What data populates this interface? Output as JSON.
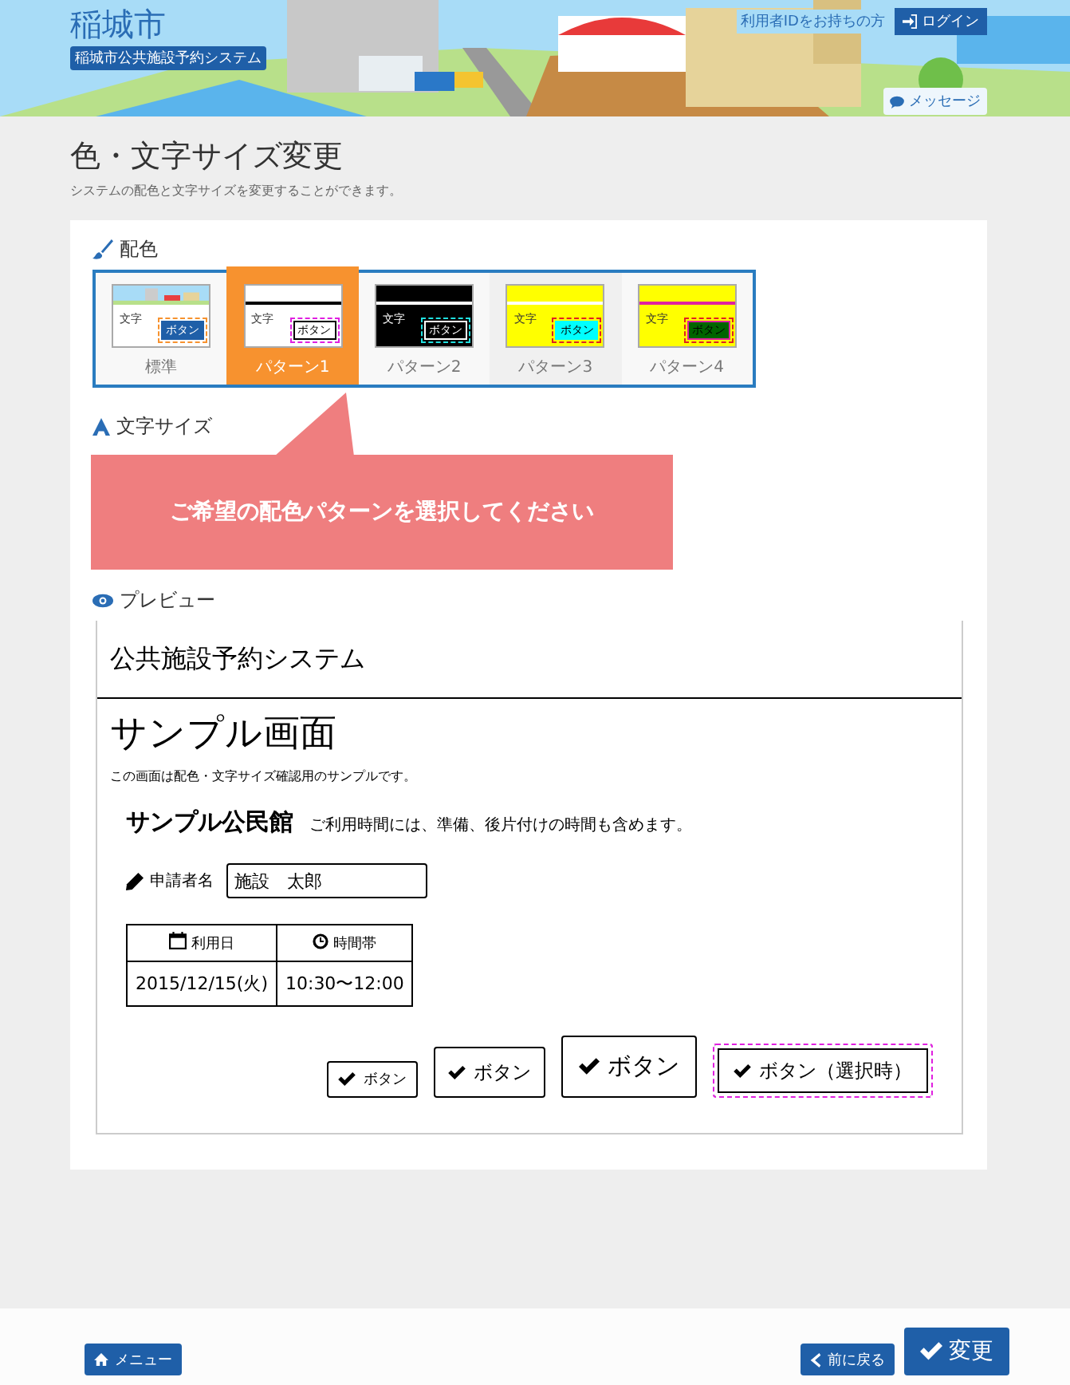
{
  "header": {
    "city": "稲城市",
    "system_badge": "稲城市公共施設予約システム",
    "login_hint": "利用者IDをお持ちの方",
    "login_button": "ログイン",
    "message_button": "メッセージ"
  },
  "page": {
    "title": "色・文字サイズ変更",
    "description": "システムの配色と文字サイズを変更することができます。"
  },
  "color_section": {
    "heading": "配色",
    "patterns": [
      {
        "kind": "standard",
        "label": "標準",
        "sample_text": "文字",
        "sample_button": "ボタン",
        "selected": false
      },
      {
        "kind": "pattern1",
        "label": "パターン1",
        "sample_text": "文字",
        "sample_button": "ボタン",
        "selected": true
      },
      {
        "kind": "pattern2",
        "label": "パターン2",
        "sample_text": "文字",
        "sample_button": "ボタン",
        "selected": false
      },
      {
        "kind": "pattern3",
        "label": "パターン3",
        "sample_text": "文字",
        "sample_button": "ボタン",
        "selected": false
      },
      {
        "kind": "pattern4",
        "label": "パターン4",
        "sample_text": "文字",
        "sample_button": "ボタン",
        "selected": false
      }
    ]
  },
  "size_section": {
    "heading": "文字サイズ"
  },
  "callout": {
    "text": "ご希望の配色パターンを選択してください"
  },
  "preview": {
    "heading": "プレビュー",
    "system_title": "公共施設予約システム",
    "screen_title": "サンプル画面",
    "description": "この画面は配色・文字サイズ確認用のサンプルです。",
    "facility_name": "サンプル公民館",
    "facility_note": "ご利用時間には、準備、後片付けの時間も含めます。",
    "applicant_label": "申請者名",
    "applicant_value": "施設　太郎",
    "table": {
      "columns": [
        {
          "kind": "date",
          "label": "利用日"
        },
        {
          "kind": "time",
          "label": "時間帯"
        }
      ],
      "rows": [
        [
          "2015/12/15(火)",
          "10:30〜12:00"
        ]
      ]
    },
    "buttons": [
      {
        "kind": "small",
        "label": "ボタン",
        "selected": false
      },
      {
        "kind": "medium",
        "label": "ボタン",
        "selected": false
      },
      {
        "kind": "large",
        "label": "ボタン",
        "selected": false
      },
      {
        "kind": "medium",
        "label": "ボタン（選択時）",
        "selected": true
      }
    ]
  },
  "footer": {
    "menu_button": "メニュー",
    "back_button": "前に戻る",
    "submit_button": "変更"
  }
}
